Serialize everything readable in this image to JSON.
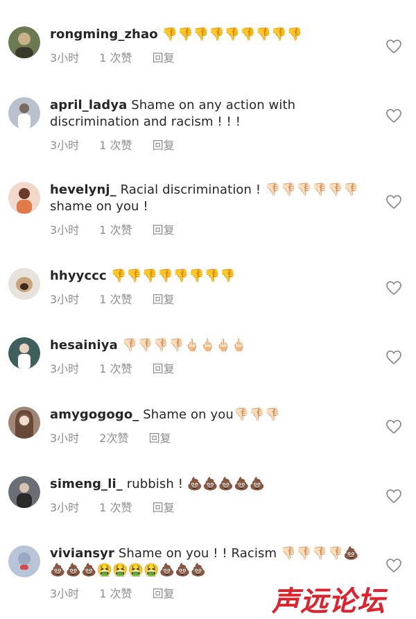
{
  "comments": [
    {
      "user": "rongming_zhao",
      "text": "👎👎👎👎👎👎👎👎👎",
      "time": "3小时",
      "likes": "1 次赞",
      "reply": "回复",
      "avatar_color": "#6b7a52"
    },
    {
      "user": "april_ladya",
      "text": "Shame on any action with discrimination and racism ! ! !",
      "time": "3小时",
      "likes": "1 次赞",
      "reply": "回复",
      "avatar_color": "#9aa6b4"
    },
    {
      "user": "hevelynj_",
      "text": "Racial discrimination ! 👎🏻👎🏻👎🏻👎🏻👎🏻👎🏻shame on you !",
      "time": "3小时",
      "likes": "1 次赞",
      "reply": "回复",
      "avatar_color": "#d99a7a"
    },
    {
      "user": "hhyyccc",
      "text": "👎👎👎👎👎👎👎👎",
      "time": "3小时",
      "likes": "1 次赞",
      "reply": "回复",
      "avatar_color": "#c9b9a4"
    },
    {
      "user": "hesainiya",
      "text": "👎🏻👎🏻👎🏻👎🏻🖕🏻🖕🏻🖕🏻🖕🏻",
      "time": "3小时",
      "likes": "1 次赞",
      "reply": "回复",
      "avatar_color": "#4a6a6a"
    },
    {
      "user": "amygogogo_",
      "text": "Shame on you👎🏻👎🏻👎🏻",
      "time": "3小时",
      "likes": "2次赞",
      "reply": "回复",
      "avatar_color": "#8a6a55"
    },
    {
      "user": "simeng_li_",
      "text": "rubbish ! 💩💩💩💩💩",
      "time": "3小时",
      "likes": "1 次赞",
      "reply": "回复",
      "avatar_color": "#5a5f66"
    },
    {
      "user": "viviansyr",
      "text": "Shame on you ! ! Racism 👎🏻👎🏻👎🏻👎🏻💩💩💩💩🤮🤮🤮🤮💩💩💩",
      "time": "3小时",
      "likes": "1 次赞",
      "reply": "回复",
      "avatar_color": "#9aa8c2"
    }
  ],
  "watermark": "声远论坛",
  "colors": {
    "username": "#262626",
    "meta": "#8e8e8e",
    "heart": "#8e8e8e",
    "watermark": "#e0212c"
  },
  "icons": {
    "like": "heart-outline-icon"
  }
}
